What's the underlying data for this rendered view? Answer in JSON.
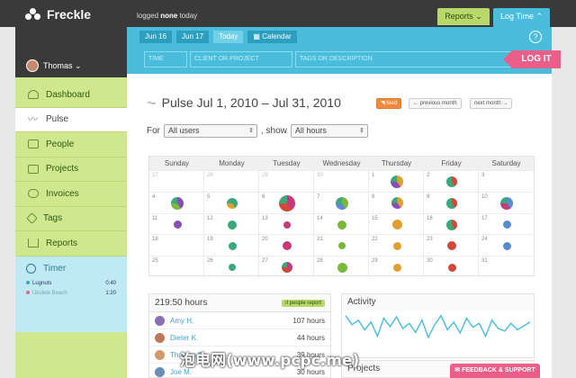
{
  "app": {
    "logo_text": "Freckle",
    "logged_prefix": "logged ",
    "logged_bold": "none",
    "logged_suffix": " today"
  },
  "header": {
    "reports_label": "Reports",
    "logtime_label": "Log Time"
  },
  "user": {
    "name": "Thomas"
  },
  "sidebar": {
    "items": [
      {
        "label": "Dashboard",
        "icon": "dashboard-icon"
      },
      {
        "label": "Pulse",
        "icon": "pulse-icon",
        "active": true
      },
      {
        "label": "People",
        "icon": "people-icon"
      },
      {
        "label": "Projects",
        "icon": "folder-icon"
      },
      {
        "label": "Invoices",
        "icon": "invoice-icon"
      },
      {
        "label": "Tags",
        "icon": "tag-icon"
      },
      {
        "label": "Reports",
        "icon": "reports-icon"
      }
    ],
    "timer": {
      "title": "Timer",
      "entries": [
        {
          "name": "Lugnuts",
          "time": "0:40",
          "color": "#3aa3c6"
        },
        {
          "name": "Ukulele Beach",
          "time": "1:20",
          "color": "#ea5e8a"
        }
      ]
    }
  },
  "logpanel": {
    "dates": [
      "Jun 16",
      "Jun 17",
      "Today"
    ],
    "calendar_label": "Calendar",
    "help": "?",
    "time_placeholder": "TIME",
    "client_placeholder": "CLIENT OR PROJECT",
    "tags_placeholder": "TAGS OR DESCRIPTION",
    "logit_label": "LOG IT"
  },
  "pulse": {
    "title": "Pulse Jul 1, 2010 – Jul 31, 2010",
    "feed_label": "feed",
    "prev_label": "← previous month",
    "next_label": "next month →",
    "for_label": "For",
    "users_value": "All users",
    "show_label": ", show",
    "hours_value": "All hours"
  },
  "calendar": {
    "weekdays": [
      "Sunday",
      "Monday",
      "Tuesday",
      "Wednesday",
      "Thursday",
      "Friday",
      "Saturday"
    ],
    "days": [
      "27",
      "28",
      "29",
      "30",
      "1",
      "2",
      "3",
      "4",
      "5",
      "6",
      "7",
      "8",
      "9",
      "10",
      "11",
      "12",
      "13",
      "14",
      "15",
      "16",
      "17",
      "18",
      "19",
      "20",
      "21",
      "22",
      "23",
      "24",
      "25",
      "26",
      "27",
      "28",
      "29",
      "30",
      "31"
    ],
    "other_month_indices": [
      0,
      1,
      2,
      3
    ]
  },
  "hours": {
    "total": "219:50 hours",
    "report_label": "people report",
    "people": [
      {
        "name": "Amy H.",
        "hours": "107 hours",
        "color": "#8a6fb5"
      },
      {
        "name": "Dieter K.",
        "hours": "44 hours",
        "color": "#c0785a"
      },
      {
        "name": "Thomas F.",
        "hours": "39 hours",
        "color": "#d19a6a"
      },
      {
        "name": "Joe M.",
        "hours": "30 hours",
        "color": "#6a8fb5"
      }
    ]
  },
  "activity": {
    "title": "Activity",
    "values": [
      62,
      48,
      55,
      40,
      52,
      30,
      58,
      45,
      60,
      42,
      50,
      36,
      55,
      28,
      48,
      62,
      40,
      52,
      35,
      58,
      44,
      50,
      30,
      55,
      42,
      38,
      50,
      40,
      46,
      52
    ]
  },
  "projects": {
    "title": "Projects"
  },
  "feedback_label": "FEEDBACK & SUPPORT",
  "watermark": "泡电网(www.pcpc.me)",
  "colors": {
    "green": "#b9d86a",
    "blue": "#49bddb",
    "pink": "#ea5e8a",
    "orange": "#f08a3a"
  }
}
